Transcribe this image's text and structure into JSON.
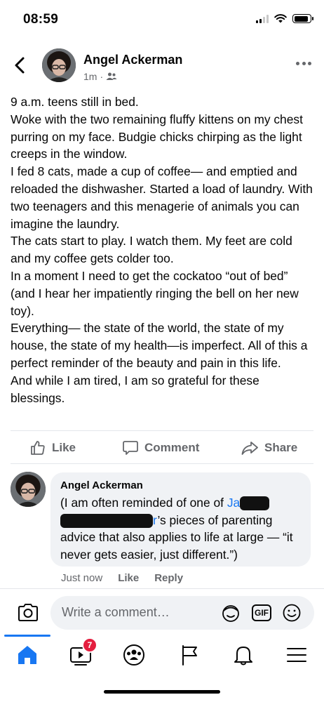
{
  "status_bar": {
    "time": "08:59",
    "battery_level": 0.9
  },
  "post": {
    "author": "Angel Ackerman",
    "time_ago": "1m",
    "separator": "·",
    "audience_icon": "friends-icon",
    "body": [
      "9 a.m. teens still in bed.",
      "Woke with the two remaining fluffy kittens on my chest purring on my face. Budgie chicks chirping as the light creeps in the window.",
      "I fed 8 cats, made a cup of coffee— and emptied and reloaded the dishwasher. Started a load of laundry. With two teenagers and this menagerie of animals you can imagine the laundry.",
      "The cats start to play. I watch them. My feet are cold and my coffee gets colder too.",
      "In a moment I need to get the cockatoo “out of bed” (and I hear her impatiently ringing the bell on her new toy).",
      "Everything— the state of the world, the state of my house, the state of my health—is imperfect. All of this a perfect reminder of the beauty and pain in this life.",
      "And while I am tired, I am so grateful for these blessings."
    ]
  },
  "actions": {
    "like": "Like",
    "comment": "Comment",
    "share": "Share"
  },
  "comment": {
    "author": "Angel Ackerman",
    "text_before": "(I am often reminded of one of ",
    "mention_start": "Ja",
    "mention_end": "r",
    "text_after": "’s pieces of parenting advice that also applies to life at large — “it never gets easier, just different.”)",
    "time": "Just now",
    "like": "Like",
    "reply": "Reply"
  },
  "input": {
    "placeholder": "Write a comment…",
    "gif_label": "GIF"
  },
  "nav": {
    "video_badge": "7",
    "items": [
      "home-icon",
      "watch-icon",
      "groups-icon",
      "pages-icon",
      "notifications-icon",
      "menu-icon"
    ]
  },
  "colors": {
    "accent": "#1877f2",
    "badge": "#e41e3f",
    "secondary_text": "#65676b"
  }
}
